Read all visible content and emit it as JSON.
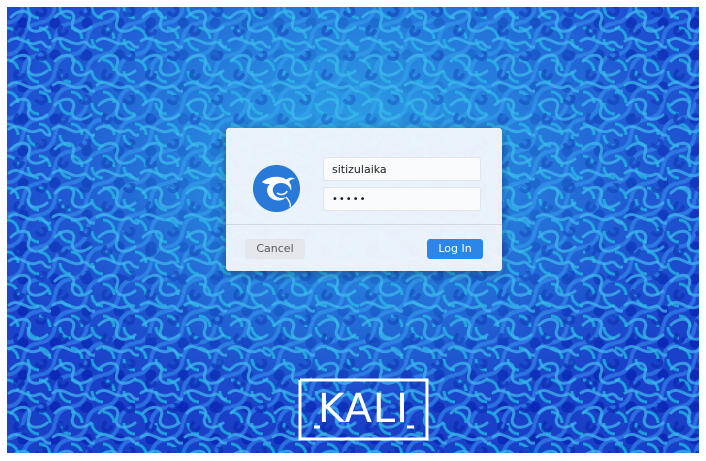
{
  "login": {
    "username": "sitizulaika",
    "password_mask": "•••••",
    "cancel_label": "Cancel",
    "login_label": "Log In"
  },
  "branding": {
    "logo_text": "KALI"
  },
  "colors": {
    "background": "#1a3fc8",
    "pattern_light": "#1f9fdd",
    "accent": "#2b86e8",
    "avatar": "#2879d8"
  },
  "icons": {
    "avatar": "kali-dragon-icon"
  }
}
